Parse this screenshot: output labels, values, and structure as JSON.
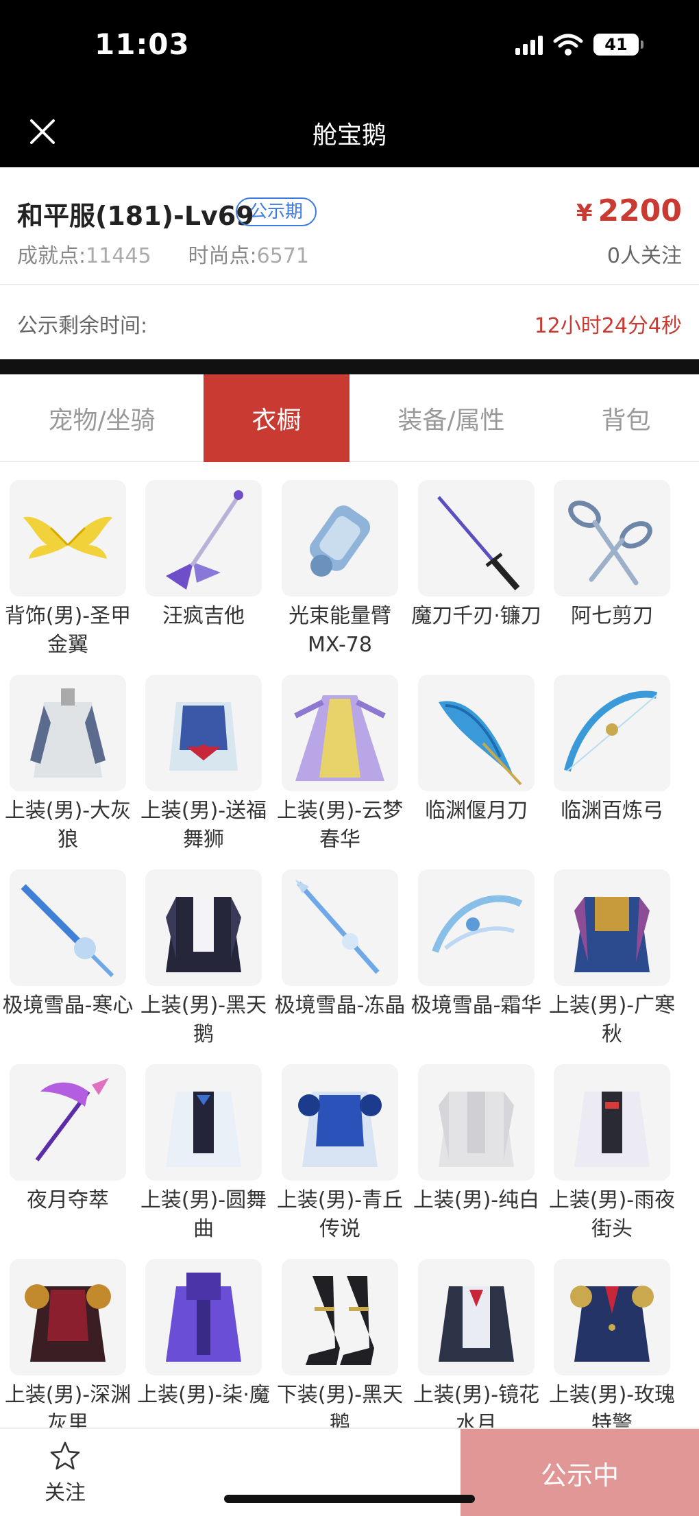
{
  "status_bar": {
    "time": "11:03",
    "battery": "41",
    "battery_level": 0.41
  },
  "nav": {
    "title": "舱宝鹅"
  },
  "header": {
    "server_title": "和平服(181)-Lv69",
    "badge": "公示期",
    "price_symbol": "¥",
    "price": "2200",
    "achievement_label": "成就点:",
    "achievement_value": "11445",
    "fashion_label": "时尚点:",
    "fashion_value": "6571",
    "followers": "0人关注"
  },
  "countdown": {
    "label": "公示剩余时间:",
    "value": "12小时24分4秒"
  },
  "tabs": [
    {
      "label": "宠物/坐骑"
    },
    {
      "label": "衣橱",
      "active": true
    },
    {
      "label": "装备/属性"
    },
    {
      "label": "背包"
    }
  ],
  "items": [
    {
      "name": "背饰(男)-圣甲金翼",
      "icon": "golden-wings-icon"
    },
    {
      "name": "汪疯吉他",
      "icon": "electric-guitar-icon"
    },
    {
      "name": "光束能量臂MX-78",
      "icon": "energy-arm-cannon-icon"
    },
    {
      "name": "魔刀千刃·镰刀",
      "icon": "katana-icon"
    },
    {
      "name": "阿七剪刀",
      "icon": "scissors-icon"
    },
    {
      "name": "上装(男)-大灰狼",
      "icon": "apron-outfit-icon"
    },
    {
      "name": "上装(男)-送福舞狮",
      "icon": "lion-dance-outfit-icon"
    },
    {
      "name": "上装(男)-云梦春华",
      "icon": "robe-outfit-icon"
    },
    {
      "name": "临渊偃月刀",
      "icon": "water-glaive-icon"
    },
    {
      "name": "临渊百炼弓",
      "icon": "water-bow-icon"
    },
    {
      "name": "极境雪晶-寒心",
      "icon": "ice-sword-icon"
    },
    {
      "name": "上装(男)-黑天鹅",
      "icon": "black-coat-outfit-icon"
    },
    {
      "name": "极境雪晶-冻晶",
      "icon": "ice-spear-icon"
    },
    {
      "name": "极境雪晶-霜华",
      "icon": "ice-bow-icon"
    },
    {
      "name": "上装(男)-广寒秋",
      "icon": "ornate-robe-outfit-icon"
    },
    {
      "name": "夜月夺萃",
      "icon": "purple-scythe-icon"
    },
    {
      "name": "上装(男)-圆舞曲",
      "icon": "waltz-coat-outfit-icon"
    },
    {
      "name": "上装(男)-青丘传说",
      "icon": "blue-armor-outfit-icon"
    },
    {
      "name": "上装(男)-纯白",
      "icon": "white-coat-outfit-icon"
    },
    {
      "name": "上装(男)-雨夜街头",
      "icon": "street-jacket-outfit-icon"
    },
    {
      "name": "上装(男)-深渊灰里",
      "icon": "dark-armor-outfit-icon"
    },
    {
      "name": "上装(男)-柒·魔",
      "icon": "purple-hoodie-outfit-icon"
    },
    {
      "name": "下装(男)-黑天鹅",
      "icon": "boots-icon"
    },
    {
      "name": "上装(男)-镜花水月",
      "icon": "mirror-vest-outfit-icon"
    },
    {
      "name": "上装(男)-玫瑰特警",
      "icon": "navy-uniform-outfit-icon"
    }
  ],
  "bottom": {
    "follow_label": "关注",
    "status_button": "公示中"
  },
  "colors": {
    "accent": "#c83a32",
    "badge": "#3d7be2",
    "status_button": "#e09796"
  }
}
